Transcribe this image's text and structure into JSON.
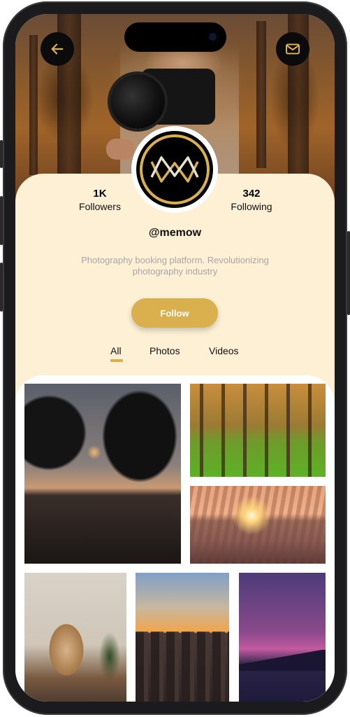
{
  "profile": {
    "followers_count": "1K",
    "followers_label": "Followers",
    "following_count": "342",
    "following_label": "Following",
    "handle": "@memow",
    "bio": "Photography booking platform. Revolutionizing photography industry",
    "follow_label": "Follow"
  },
  "tabs": [
    {
      "label": "All",
      "active": true
    },
    {
      "label": "Photos",
      "active": false
    },
    {
      "label": "Videos",
      "active": false
    }
  ],
  "icons": {
    "back": "back-arrow-icon",
    "message": "mail-icon",
    "logo": "memow-logo"
  },
  "colors": {
    "accent": "#d9b04d",
    "card_background": "#fdf0d5",
    "bio_text": "#a7a7a7"
  }
}
